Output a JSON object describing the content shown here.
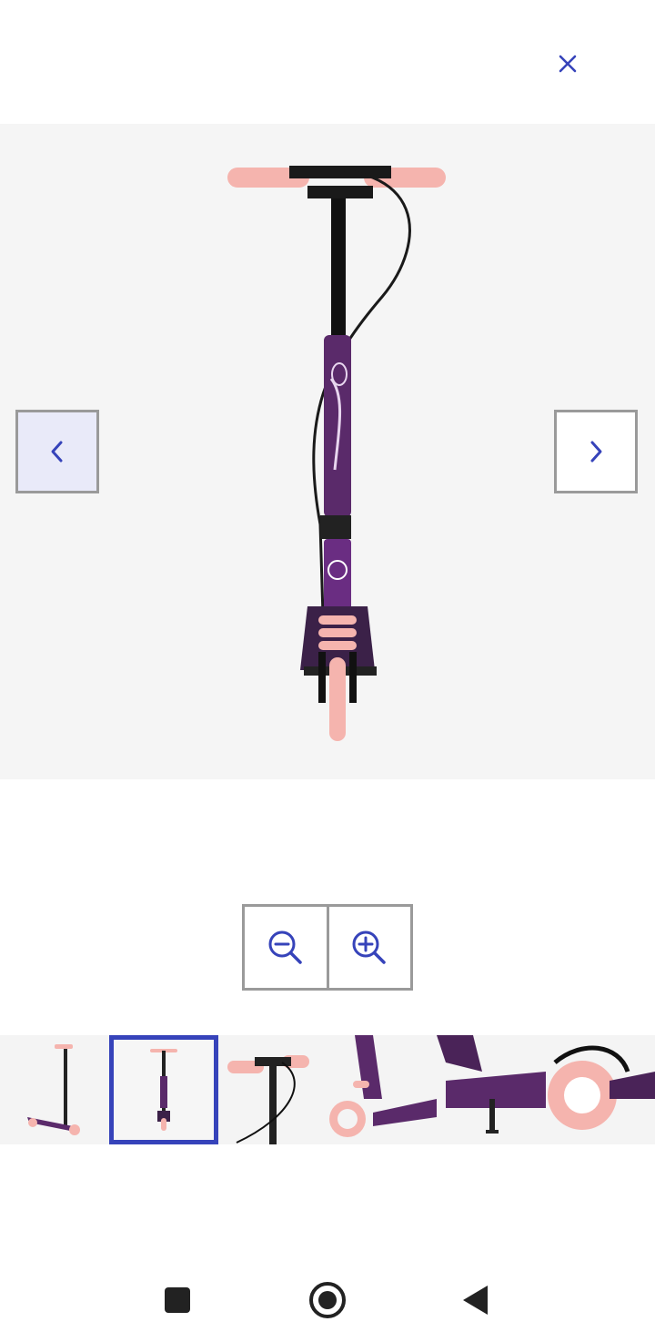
{
  "header": {
    "close_icon": "close-icon"
  },
  "viewer": {
    "image_description_icon": "scooter-front-view",
    "prev_icon": "chevron-left-icon",
    "next_icon": "chevron-right-icon",
    "active_thumbnail_index": 1
  },
  "zoom": {
    "zoom_out_icon": "zoom-out-icon",
    "zoom_in_icon": "zoom-in-icon"
  },
  "thumbnails": [
    {
      "name": "scooter-side"
    },
    {
      "name": "scooter-front"
    },
    {
      "name": "handlebar-closeup"
    },
    {
      "name": "front-wheel-suspension"
    },
    {
      "name": "kickstand-closeup"
    },
    {
      "name": "rear-wheel-brake"
    }
  ],
  "system_nav": {
    "recent_icon": "square-icon",
    "home_icon": "circle-icon",
    "back_icon": "triangle-back-icon"
  },
  "colors": {
    "accent": "#3643ba",
    "border": "#9a9a9a",
    "scooter_purple": "#5a2a6a",
    "grip_pink": "#f5b4ae"
  }
}
